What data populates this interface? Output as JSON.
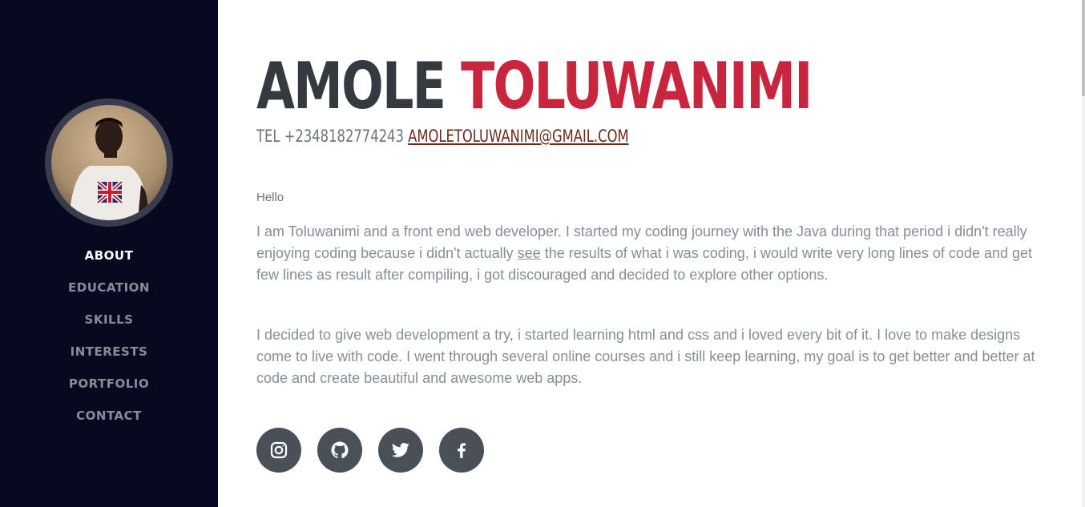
{
  "sidebar": {
    "nav": [
      {
        "label": "ABOUT",
        "active": true
      },
      {
        "label": "EDUCATION",
        "active": false
      },
      {
        "label": "SKILLS",
        "active": false
      },
      {
        "label": "INTERESTS",
        "active": false
      },
      {
        "label": "PORTFOLIO",
        "active": false
      },
      {
        "label": "CONTACT",
        "active": false
      }
    ]
  },
  "header": {
    "first_name": "AMOLE",
    "last_name": "TOLUWANIMI",
    "phone": "TEL +2348182774243",
    "email": "AMOLETOLUWANIMI@GMAIL.COM"
  },
  "about": {
    "greeting": "Hello",
    "paragraph1_before": "I am Toluwanimi and a front end web developer. I started my coding journey with the Java during that period i didn't really enjoying coding because i didn't actually ",
    "paragraph1_link": "see",
    "paragraph1_after": " the results of what i was coding, i would write very long lines of code and get few lines as result after compiling, i got discouraged and decided to explore other options.",
    "paragraph2": "I decided to give web development a try, i started learning html and css and i loved every bit of it. I love to make designs come to live with code. I went through several online courses and i still keep learning, my goal is to get better and better at code and create beautiful and awesome web apps."
  },
  "social": {
    "icons": [
      "instagram-icon",
      "github-icon",
      "twitter-icon",
      "facebook-icon"
    ]
  },
  "colors": {
    "sidebar_bg": "#070921",
    "accent": "#c9253f",
    "heading": "#343a40",
    "social_bg": "#495057"
  }
}
